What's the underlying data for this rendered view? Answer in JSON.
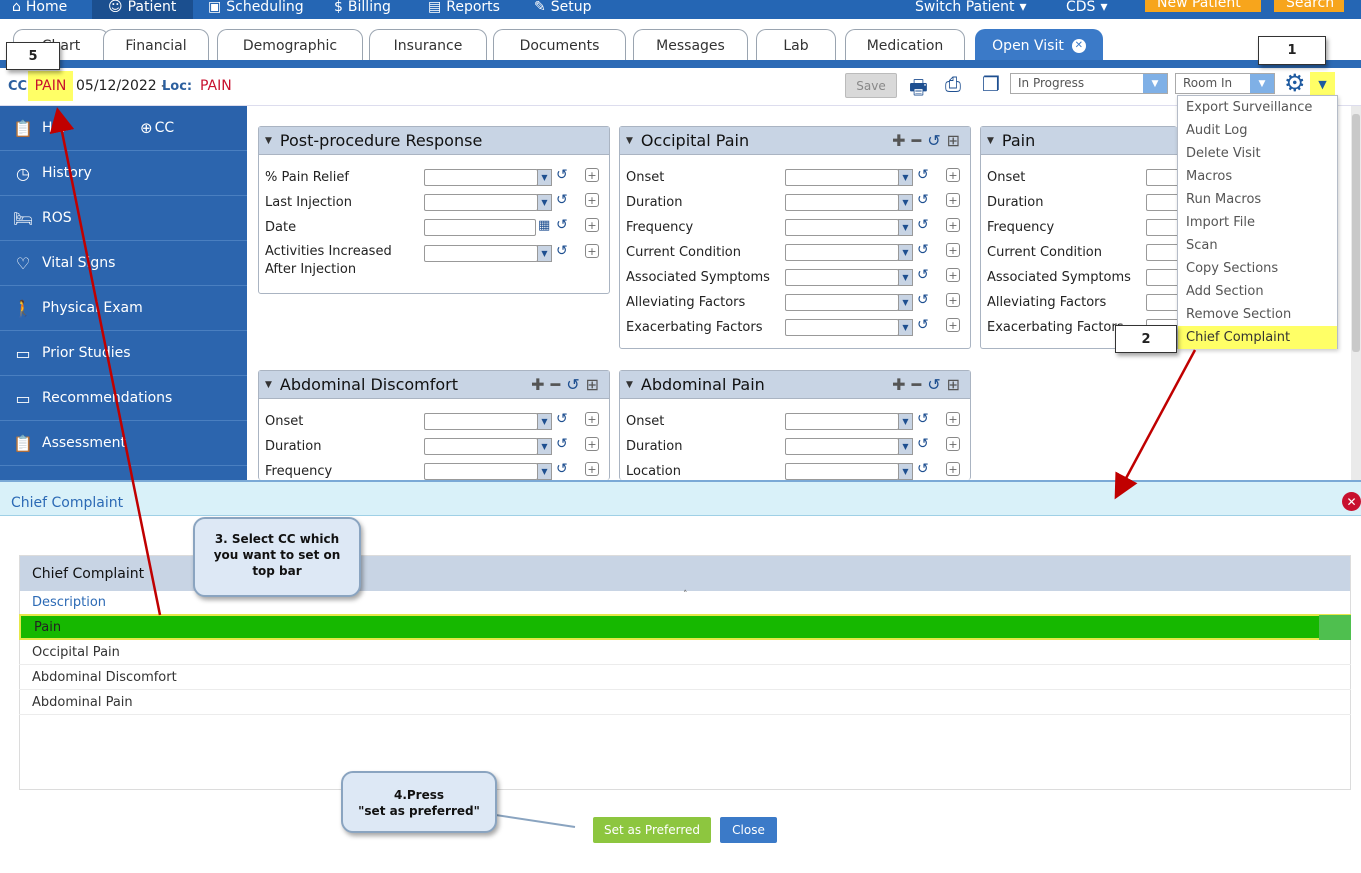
{
  "topnav": {
    "items": [
      "Home",
      "Patient",
      "Scheduling",
      "Billing",
      "Reports",
      "Setup"
    ],
    "switch_patient": "Switch Patient",
    "user": "CDS",
    "new_patient": "New Patient",
    "search": "Search"
  },
  "tabs": [
    "Chart",
    "Financial",
    "Demographic",
    "Insurance",
    "Documents",
    "Messages",
    "Lab",
    "Medication",
    "Open Visit"
  ],
  "ccbar": {
    "cc_label": "CC:",
    "cc_value": "PAIN",
    "date": "05/12/2022 -",
    "loc_label": "Loc:",
    "loc_value": "PAIN",
    "save": "Save",
    "status": "In Progress",
    "room": "Room In"
  },
  "sidebar": {
    "hpi": "HPI",
    "cc": "CC",
    "items": [
      "History",
      "ROS",
      "Vital Signs",
      "Physical Exam",
      "Prior Studies",
      "Recommendations",
      "Assessment"
    ]
  },
  "panels": {
    "post": {
      "title": "Post-procedure Response",
      "rows": [
        "% Pain Relief",
        "Last Injection",
        "Date",
        "Activities Increased After Injection"
      ]
    },
    "occipital": {
      "title": "Occipital Pain",
      "rows": [
        "Onset",
        "Duration",
        "Frequency",
        "Current Condition",
        "Associated Symptoms",
        "Alleviating Factors",
        "Exacerbating Factors"
      ]
    },
    "pain": {
      "title": "Pain",
      "rows": [
        "Onset",
        "Duration",
        "Frequency",
        "Current Condition",
        "Associated Symptoms",
        "Alleviating Factors",
        "Exacerbating Factors"
      ]
    },
    "abd_discomfort": {
      "title": "Abdominal Discomfort",
      "rows": [
        "Onset",
        "Duration",
        "Frequency"
      ]
    },
    "abd_pain": {
      "title": "Abdominal Pain",
      "rows": [
        "Onset",
        "Duration",
        "Location"
      ]
    }
  },
  "menu": [
    "Export Surveillance",
    "Audit Log",
    "Delete Visit",
    "Macros",
    "Run Macros",
    "Import File",
    "Scan",
    "Copy Sections",
    "Add Section",
    "Remove Section",
    "Chief Complaint"
  ],
  "dialog": {
    "title": "Chief Complaint",
    "grid_title": "Chief Complaint",
    "column": "Description",
    "rows": [
      "Pain",
      "Occipital Pain",
      "Abdominal Discomfort",
      "Abdominal Pain"
    ],
    "set_pref": "Set as Preferred",
    "close": "Close"
  },
  "annotations": {
    "n1": "1",
    "n2": "2",
    "n5": "5",
    "callout3": "3. Select CC which you want to set on top bar",
    "callout4_line1": "4.Press",
    "callout4_line2": "\"set as preferred\""
  },
  "colors": {
    "nav_blue": "#2566b4",
    "highlight_yellow": "#ffff66",
    "selected_green": "#16b800",
    "alert_red": "#c8102e",
    "arrow_red": "#c00000"
  }
}
